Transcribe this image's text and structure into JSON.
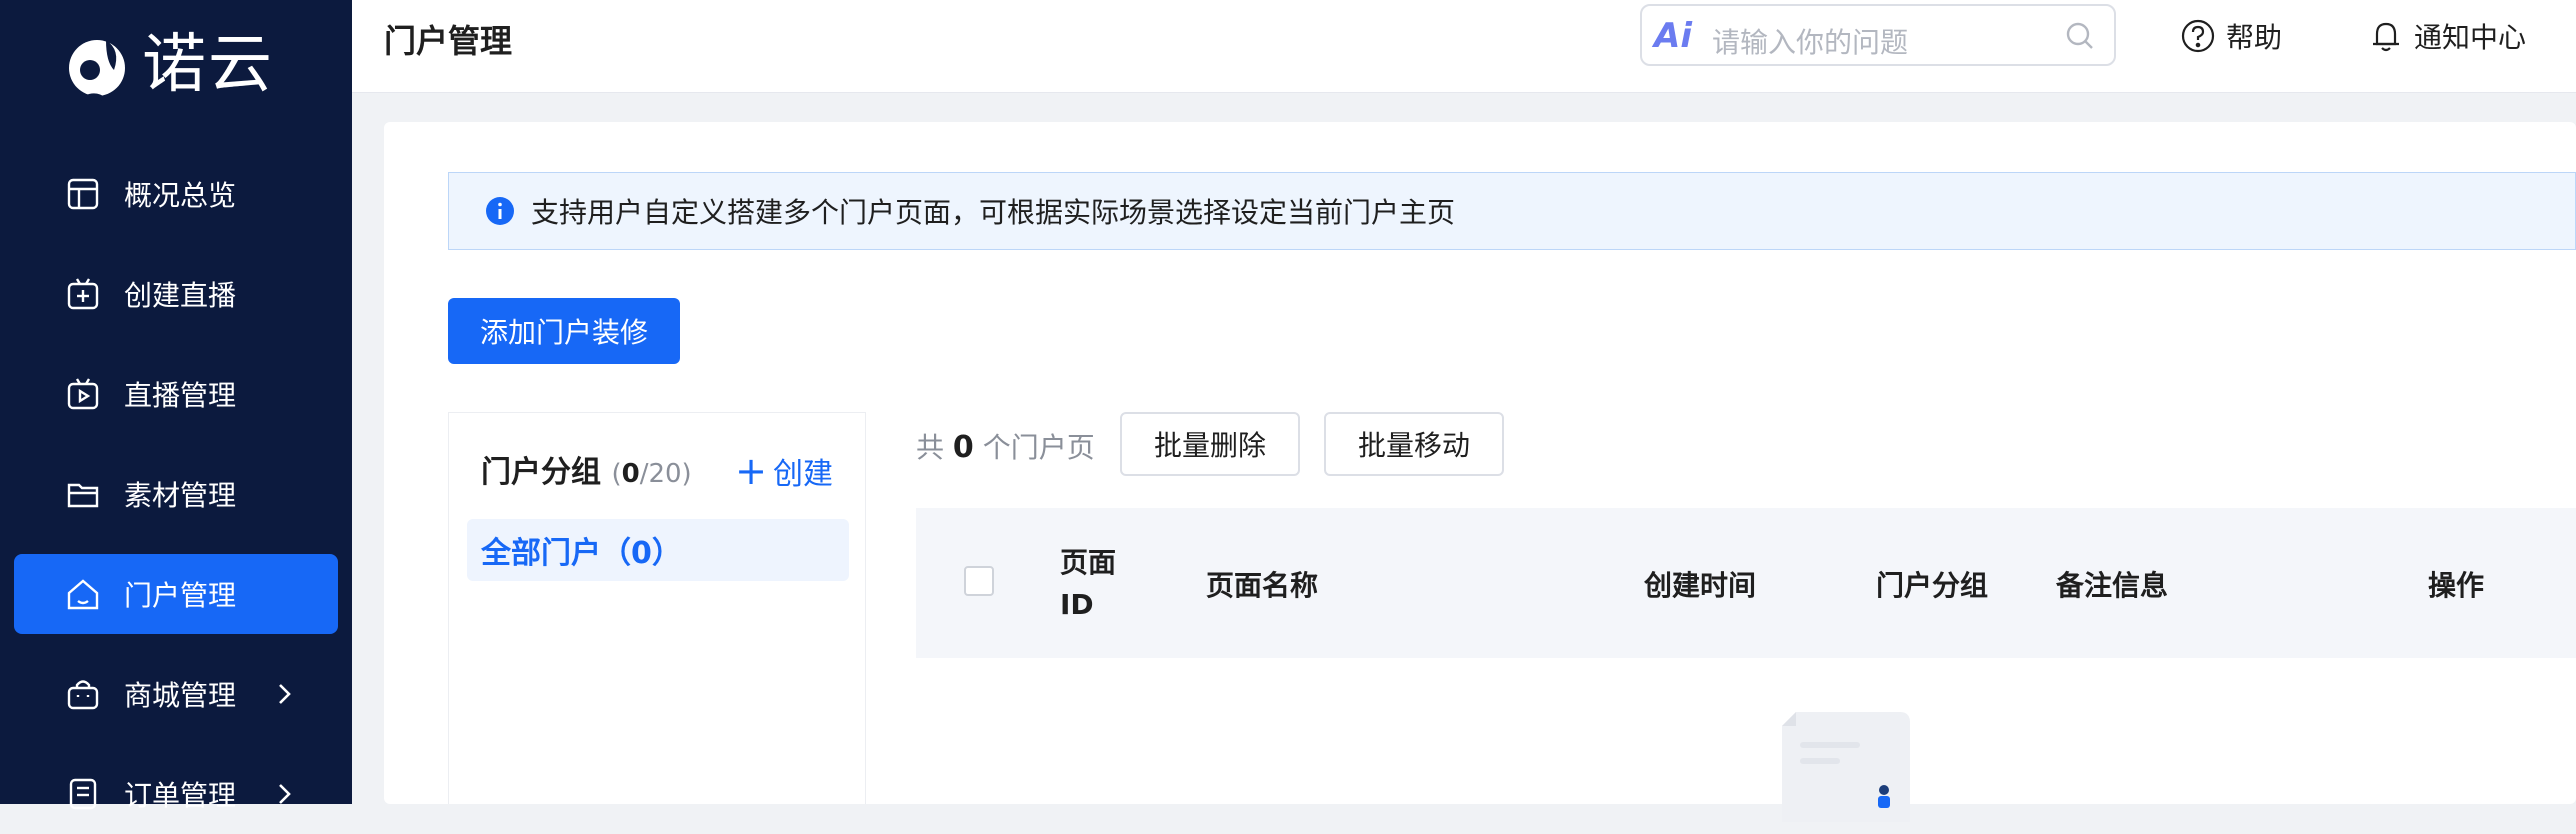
{
  "app": {
    "logo_text": "诺云"
  },
  "sidebar": {
    "items": [
      {
        "label": "概况总览",
        "icon": "dashboard-icon"
      },
      {
        "label": "创建直播",
        "icon": "create-live-icon"
      },
      {
        "label": "直播管理",
        "icon": "tv-icon"
      },
      {
        "label": "素材管理",
        "icon": "folder-icon"
      },
      {
        "label": "门户管理",
        "icon": "home-icon",
        "active": true
      },
      {
        "label": "商城管理",
        "icon": "bag-icon",
        "has_submenu": true
      },
      {
        "label": "订单管理",
        "icon": "order-icon",
        "has_submenu": true
      }
    ]
  },
  "header": {
    "title": "门户管理",
    "search_placeholder": "请输入你的问题",
    "ai_badge": "Ai",
    "help_label": "帮助",
    "notify_label": "通知中心"
  },
  "main": {
    "tip": "支持用户自定义搭建多个门户页面，可根据实际场景选择设定当前门户主页",
    "add_button": "添加门户装修",
    "group_panel": {
      "title": "门户分组",
      "count_open": "(",
      "count_current": "0",
      "count_rest": "/20)",
      "create_label": "创建",
      "items": [
        {
          "label": "全部门户（0）"
        }
      ]
    },
    "list": {
      "total_prefix": "共",
      "total_count": "0",
      "total_suffix": "个门户页",
      "batch_delete": "批量删除",
      "batch_move": "批量移动",
      "columns": {
        "page_id_1": "页面",
        "page_id_2": "ID",
        "page_name": "页面名称",
        "created_at": "创建时间",
        "group": "门户分组",
        "remark": "备注信息",
        "actions": "操作"
      }
    }
  },
  "colors": {
    "sidebar_bg": "#0c1a3e",
    "accent": "#1768f6",
    "tip_bg": "#eef5fe"
  }
}
